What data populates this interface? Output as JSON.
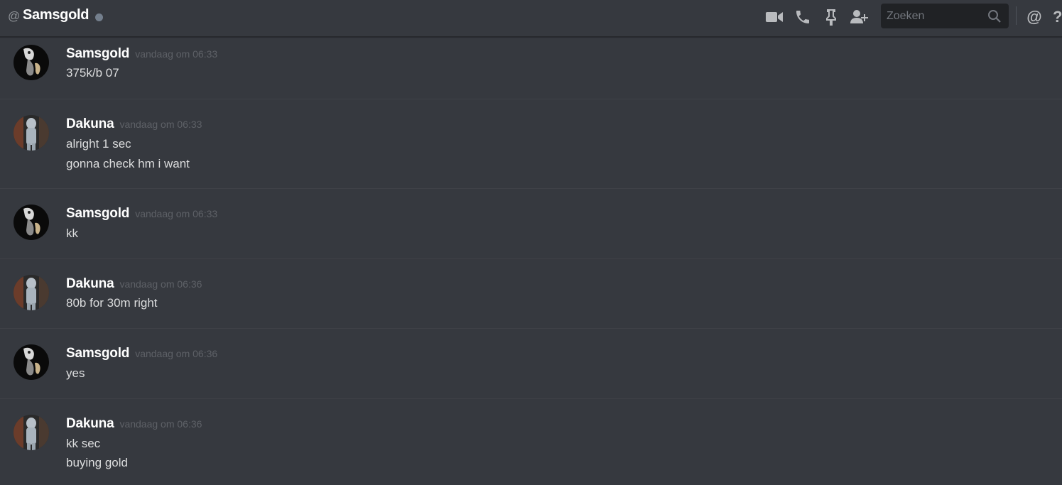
{
  "header": {
    "at_symbol": "@",
    "channel_name": "Samsgold",
    "status_color": "#747f8d",
    "icons": [
      "video-camera-icon",
      "phone-icon",
      "pin-icon",
      "add-friend-icon",
      "mentions-icon",
      "help-icon"
    ],
    "search_placeholder": "Zoeken",
    "mentions_symbol": "@",
    "help_symbol": "?"
  },
  "messages": [
    {
      "author": "Samsgold",
      "timestamp": "vandaag om 06:33",
      "avatar": "samsgold-avatar",
      "lines": [
        "375k/b 07"
      ]
    },
    {
      "author": "Dakuna",
      "timestamp": "vandaag om 06:33",
      "avatar": "dakuna-avatar",
      "lines": [
        "alright 1 sec",
        "gonna check hm i want"
      ]
    },
    {
      "author": "Samsgold",
      "timestamp": "vandaag om 06:33",
      "avatar": "samsgold-avatar",
      "lines": [
        "kk"
      ]
    },
    {
      "author": "Dakuna",
      "timestamp": "vandaag om 06:36",
      "avatar": "dakuna-avatar",
      "lines": [
        "80b for 30m right"
      ]
    },
    {
      "author": "Samsgold",
      "timestamp": "vandaag om 06:36",
      "avatar": "samsgold-avatar",
      "lines": [
        "yes"
      ]
    },
    {
      "author": "Dakuna",
      "timestamp": "vandaag om 06:36",
      "avatar": "dakuna-avatar",
      "lines": [
        "kk sec",
        "buying gold"
      ]
    }
  ],
  "colors": {
    "background": "#36393f",
    "username": "#ffffff",
    "timestamp": "#5e6167",
    "message_text": "#dcddde",
    "icon": "#b9bbbe"
  }
}
